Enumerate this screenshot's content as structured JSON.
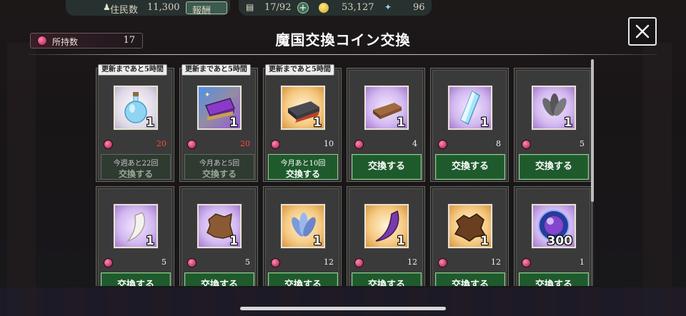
{
  "hud": {
    "residents_label": "住民数",
    "residents_value": "11,300",
    "report_label": "報酬",
    "capacity": "17/92",
    "gold": "53,127",
    "crystals": "96"
  },
  "header": {
    "holding_label": "所持数",
    "holding_value": "17",
    "title": "魔国交換コイン交換"
  },
  "items": [
    {
      "timer": "更新まであと5時間",
      "icon": "potion-bottle-icon",
      "rarity": "white",
      "qty": "1",
      "cost": "20",
      "cost_color": "red",
      "limit_line1": "今週あと22回",
      "button": "交換する",
      "enabled": false
    },
    {
      "timer": "更新まであと5時間",
      "icon": "magic-scroll-box-icon",
      "rarity": "rainbow",
      "qty": "1",
      "cost": "20",
      "cost_color": "red",
      "limit_line1": "今月あと5回",
      "button": "交換する",
      "enabled": false
    },
    {
      "timer": "更新まであと5時間",
      "icon": "dark-ingot-icon",
      "rarity": "gold",
      "qty": "1",
      "cost": "10",
      "cost_color": "white",
      "limit_line1": "今月あと10回",
      "button": "交換する",
      "enabled": true
    },
    {
      "timer": "",
      "icon": "bronze-ingot-icon",
      "rarity": "purple",
      "qty": "1",
      "cost": "4",
      "cost_color": "white",
      "limit_line1": "",
      "button": "交換する",
      "enabled": true
    },
    {
      "timer": "",
      "icon": "blue-crystal-icon",
      "rarity": "purple",
      "qty": "1",
      "cost": "8",
      "cost_color": "white",
      "limit_line1": "",
      "button": "交換する",
      "enabled": true
    },
    {
      "timer": "",
      "icon": "grey-feathers-icon",
      "rarity": "purple",
      "qty": "1",
      "cost": "5",
      "cost_color": "white",
      "limit_line1": "",
      "button": "交換する",
      "enabled": true
    },
    {
      "timer": "",
      "icon": "white-fang-icon",
      "rarity": "purple",
      "qty": "1",
      "cost": "5",
      "cost_color": "white",
      "limit_line1": "",
      "button": "交換する",
      "enabled": true
    },
    {
      "timer": "",
      "icon": "leather-hide-icon",
      "rarity": "purple",
      "qty": "1",
      "cost": "5",
      "cost_color": "white",
      "limit_line1": "",
      "button": "交換する",
      "enabled": true
    },
    {
      "timer": "",
      "icon": "blue-feathers-icon",
      "rarity": "gold",
      "qty": "1",
      "cost": "12",
      "cost_color": "white",
      "limit_line1": "",
      "button": "交換する",
      "enabled": true
    },
    {
      "timer": "",
      "icon": "purple-horn-icon",
      "rarity": "gold",
      "qty": "1",
      "cost": "12",
      "cost_color": "white",
      "limit_line1": "",
      "button": "交換する",
      "enabled": true
    },
    {
      "timer": "",
      "icon": "beast-pelt-icon",
      "rarity": "gold",
      "qty": "1",
      "cost": "12",
      "cost_color": "white",
      "limit_line1": "",
      "button": "交換する",
      "enabled": true
    },
    {
      "timer": "",
      "icon": "magic-orb-icon",
      "rarity": "purple",
      "qty": "300",
      "cost": "1",
      "cost_color": "white",
      "limit_line1": "",
      "button": "交換する",
      "enabled": true
    }
  ]
}
